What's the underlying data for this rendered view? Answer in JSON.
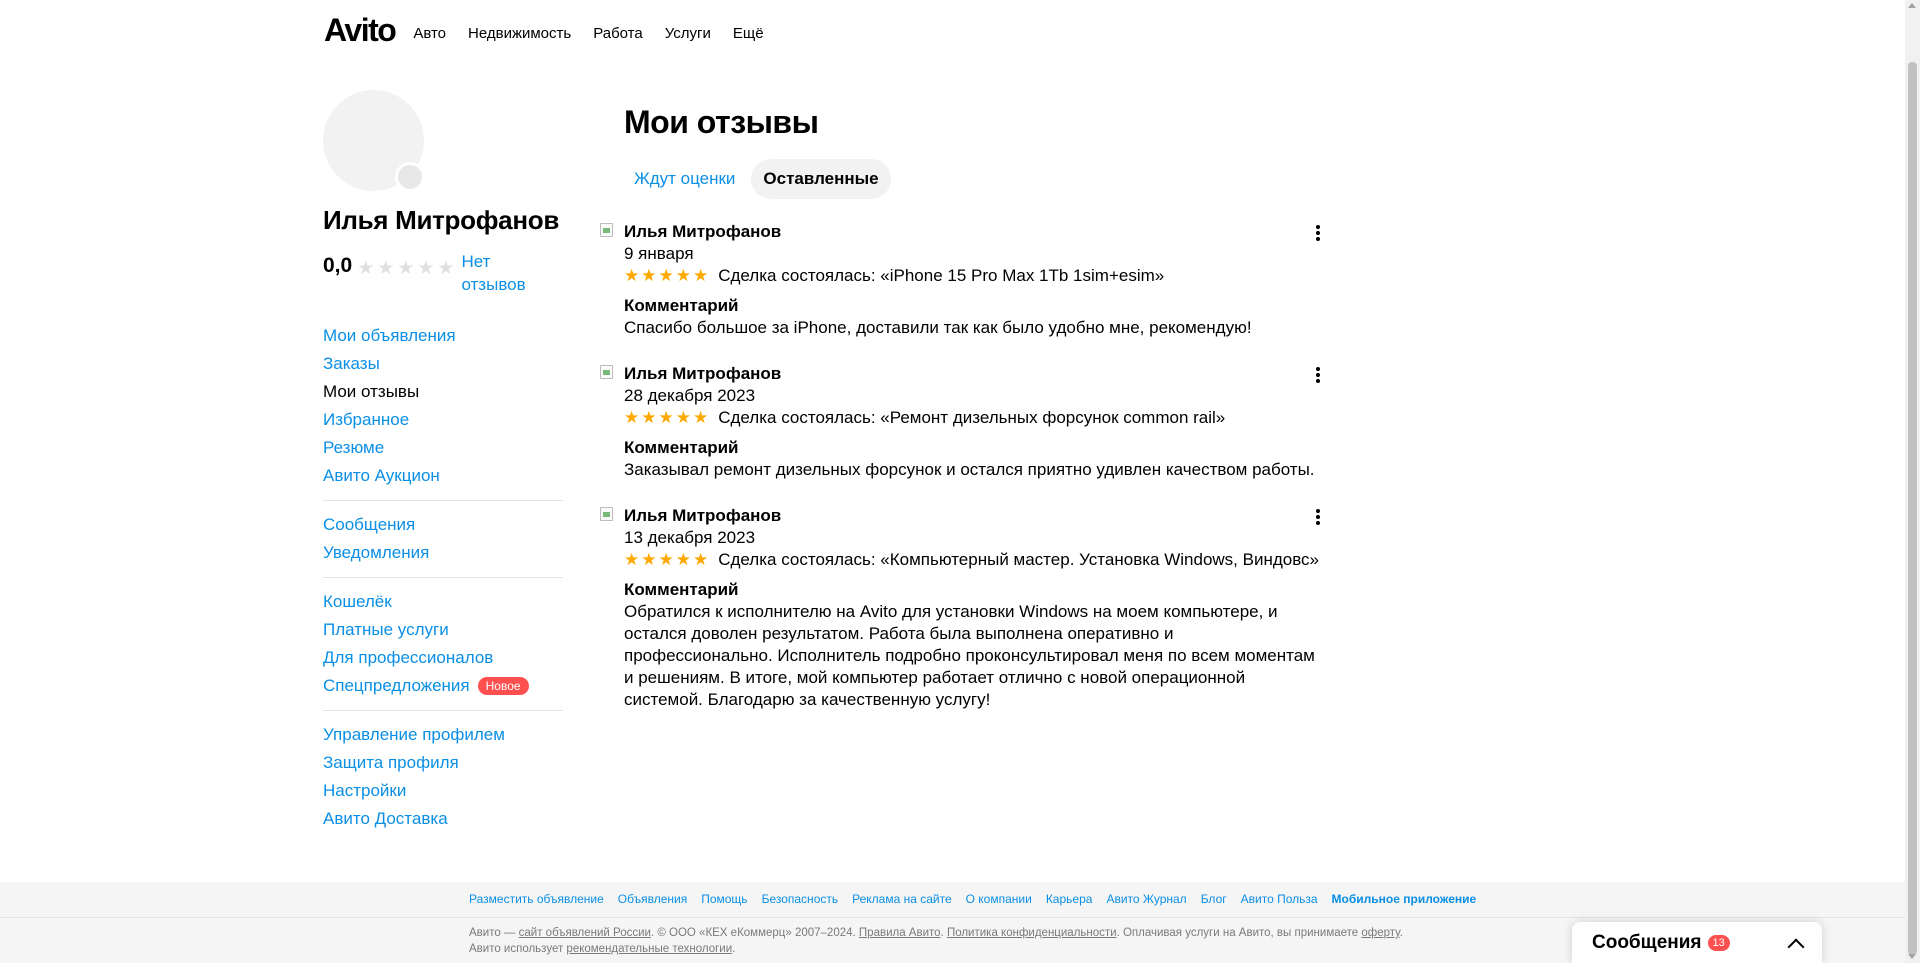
{
  "header": {
    "logo": "Avito",
    "nav": [
      "Авто",
      "Недвижимость",
      "Работа",
      "Услуги",
      "Ещё"
    ]
  },
  "profile": {
    "name": "Илья Митрофанов",
    "rating": "0,0",
    "rating_stars_filled": 0,
    "no_reviews": "Нет отзывов"
  },
  "sidebar": {
    "groups": [
      [
        {
          "label": "Мои объявления",
          "active": false
        },
        {
          "label": "Заказы",
          "active": false
        },
        {
          "label": "Мои отзывы",
          "active": true
        },
        {
          "label": "Избранное",
          "active": false
        },
        {
          "label": "Резюме",
          "active": false
        },
        {
          "label": "Авито Аукцион",
          "active": false
        }
      ],
      [
        {
          "label": "Сообщения",
          "active": false
        },
        {
          "label": "Уведомления",
          "active": false
        }
      ],
      [
        {
          "label": "Кошелёк",
          "active": false
        },
        {
          "label": "Платные услуги",
          "active": false
        },
        {
          "label": "Для профессионалов",
          "active": false
        },
        {
          "label": "Спецпредложения",
          "active": false,
          "badge": "Новое"
        }
      ],
      [
        {
          "label": "Управление профилем",
          "active": false
        },
        {
          "label": "Защита профиля",
          "active": false
        },
        {
          "label": "Настройки",
          "active": false
        },
        {
          "label": "Авито Доставка",
          "active": false
        }
      ]
    ]
  },
  "main": {
    "title": "Мои отзывы",
    "tabs": [
      {
        "label": "Ждут оценки",
        "selected": false
      },
      {
        "label": "Оставленные",
        "selected": true
      }
    ],
    "reviews": [
      {
        "author": "Илья Митрофанов",
        "date": "9 января",
        "stars": 5,
        "deal": "Сделка состоялась: «iPhone 15 Pro Max 1Tb 1sim+esim»",
        "comment_label": "Комментарий",
        "comment": "Спасибо большое за iPhone, доставили так как было удобно мне, рекомендую!"
      },
      {
        "author": "Илья Митрофанов",
        "date": "28 декабря 2023",
        "stars": 5,
        "deal": "Сделка состоялась: «Ремонт дизельных форсунок common rail»",
        "comment_label": "Комментарий",
        "comment": "Заказывал ремонт дизельных форсунок и остался приятно удивлен качеством работы."
      },
      {
        "author": "Илья Митрофанов",
        "date": "13 декабря 2023",
        "stars": 5,
        "deal": "Сделка состоялась: «Компьютерный мастер. Установка Windows, Виндовс»",
        "comment_label": "Комментарий",
        "comment": "Обратился к исполнителю на Avito для установки Windows на моем компьютере, и остался доволен результатом. Работа была выполнена оперативно и профессионально. Исполнитель подробно проконсультировал меня по всем моментам и решениям. В итоге, мой компьютер работает отлично с новой операционной системой. Благодарю за качественную услугу!"
      }
    ]
  },
  "footer": {
    "links": [
      "Разместить объявление",
      "Объявления",
      "Помощь",
      "Безопасность",
      "Реклама на сайте",
      "О компании",
      "Карьера",
      "Авито Журнал",
      "Блог",
      "Авито Польза",
      "Мобильное приложение"
    ],
    "legal": {
      "p1": "Авито — ",
      "l1": "сайт объявлений России",
      "p2": ". © ООО «КЕХ eКоммерц» 2007–2024. ",
      "l2": "Правила Авито",
      "p3": ". ",
      "l3": "Политика конфиденциальности",
      "p4": ". Оплачивая услуги на Авито, вы принимаете ",
      "l4": "оферту",
      "p5": ". Авито использует ",
      "l5": "рекомендательные технологии",
      "p6": "."
    }
  },
  "messenger": {
    "title": "Сообщения",
    "count": "13"
  },
  "colors": {
    "link": "#0a8fe6",
    "star": "#ffa800",
    "badge": "#ff4f4f"
  }
}
